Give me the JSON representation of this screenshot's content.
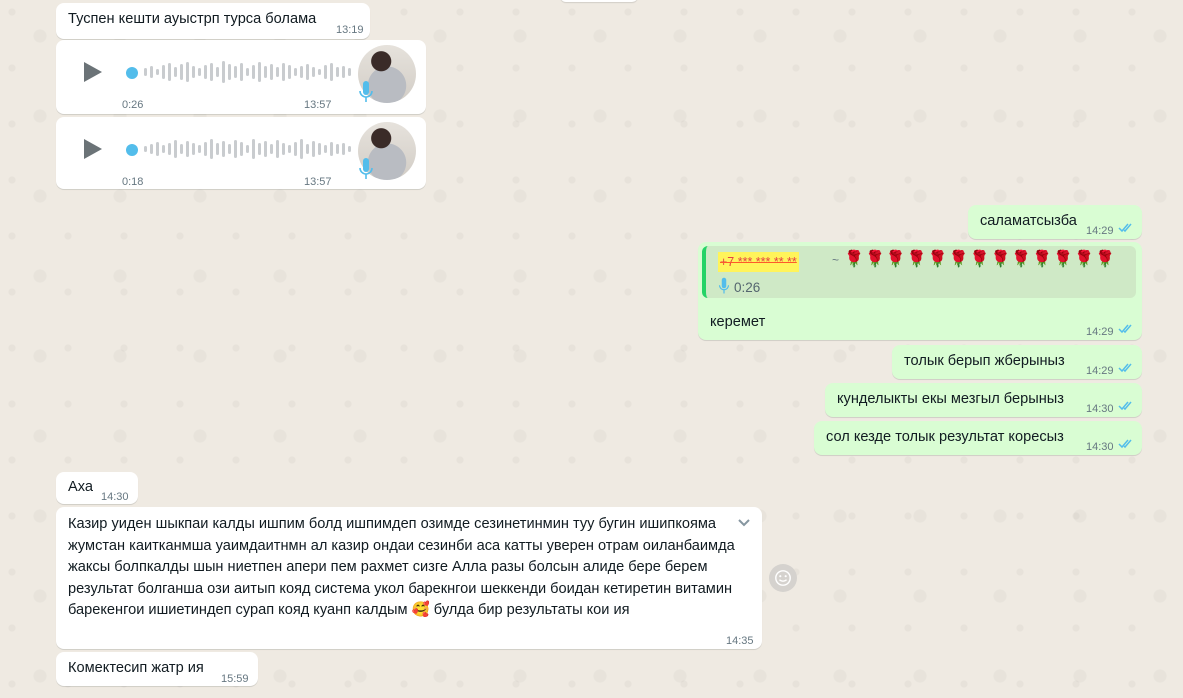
{
  "messages": [
    {
      "text": "Туспен кешти ауыстрп турса болама",
      "time": "13:19"
    },
    {
      "duration": "0:26",
      "time": "13:57"
    },
    {
      "duration": "0:18",
      "time": "13:57"
    },
    {
      "text": "саламатсызба",
      "time": "14:29"
    },
    {
      "quote_author": "+7 *** *** ** **",
      "quote_tilde": "~",
      "quote_roses": "🌹🌹🌹🌹🌹🌹🌹🌹🌹🌹🌹🌹🌹",
      "quote_duration": "0:26",
      "text": "керемет",
      "time": "14:29"
    },
    {
      "text": "толык берып жберыныз",
      "time": "14:29"
    },
    {
      "text": "кунделыкты екы мезгыл берыныз",
      "time": "14:30"
    },
    {
      "text": "сол кезде толык результат коресыз",
      "time": "14:30"
    },
    {
      "text": "Аха",
      "time": "14:30"
    },
    {
      "text": "Казир уиден шыкпаи калды ишпим болд ишпимдеп озимде сезинетинмин туу бугин ишипкояма жумстан каитканмша уаимдаитнмн ал казир ондаи сезинби аса катты уверен отрам оиланбаимда жаксы болпкалды шын ниетпен апери пем рахмет сизге Алла разы болсын алиде бере берем результат болганша ози аитып кояд система укол барекнгои шеккенди боидан кетиретин витамин барекенгои ишиетиндеп сурап кояд куанп калдым 🥰 булда бир результаты кои ия",
      "time": "14:35"
    },
    {
      "text": "Комектесип жатр ия",
      "time": "15:59"
    }
  ],
  "icons": {
    "play": "play-icon",
    "mic": "microphone-icon",
    "ticks": "double-check-icon",
    "chevron": "chevron-down-icon",
    "emoji": "smiley-icon"
  },
  "colors": {
    "incoming": "#ffffff",
    "outgoing": "#d9fdd3",
    "read_ticks": "#53bdeb",
    "background": "#efeae2"
  }
}
